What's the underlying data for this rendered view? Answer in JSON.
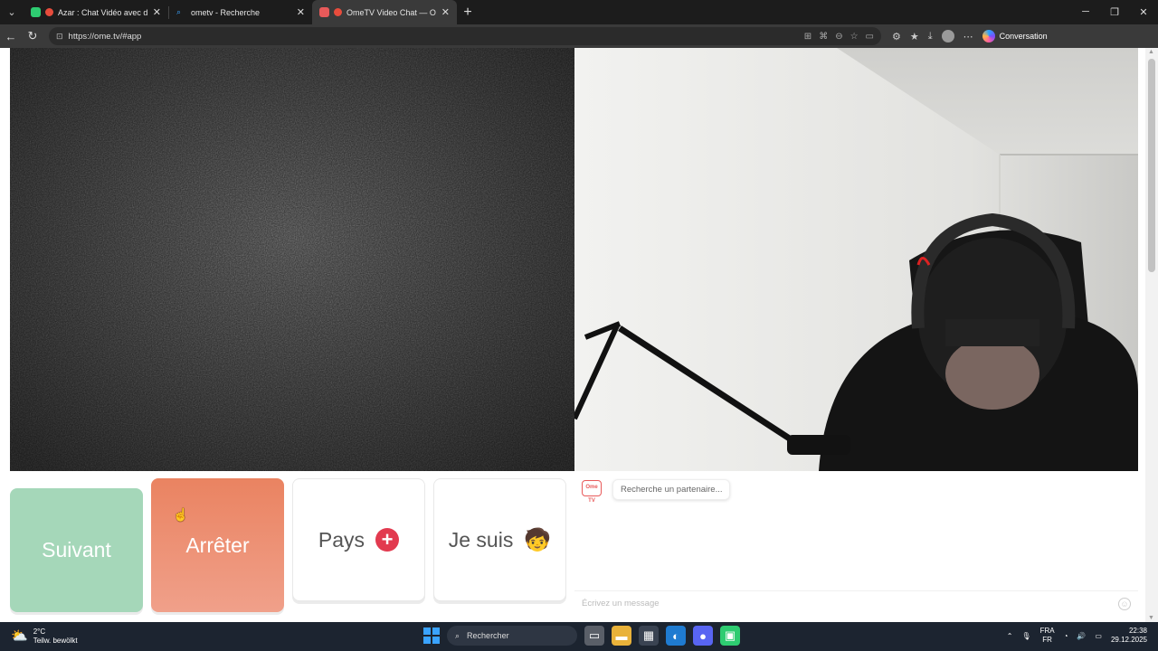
{
  "browser": {
    "tabs": [
      {
        "title": "Azar : Chat Vidéo avec de nou",
        "active": false
      },
      {
        "title": "ometv - Recherche",
        "active": false
      },
      {
        "title": "OmeTV Video Chat — Omegl",
        "active": true
      }
    ],
    "url": "https://ome.tv/#app",
    "copilot_label": "Conversation"
  },
  "app": {
    "buttons": {
      "next": "Suivant",
      "stop": "Arrêter",
      "country": "Pays",
      "gender": "Je suis"
    },
    "chat": {
      "logo_text": "Ome TV",
      "status_message": "Recherche un partenaire...",
      "input_placeholder": "Écrivez un message"
    }
  },
  "taskbar": {
    "weather_temp": "2°C",
    "weather_desc": "Teilw. bewölkt",
    "search_label": "Rechercher",
    "lang_top": "FRA",
    "lang_bottom": "FR",
    "time": "22:38",
    "date": "29.12.2025"
  },
  "colors": {
    "next_button": "#a5d7b9",
    "stop_button": "#ea8361",
    "accent_red": "#e23a4f"
  }
}
